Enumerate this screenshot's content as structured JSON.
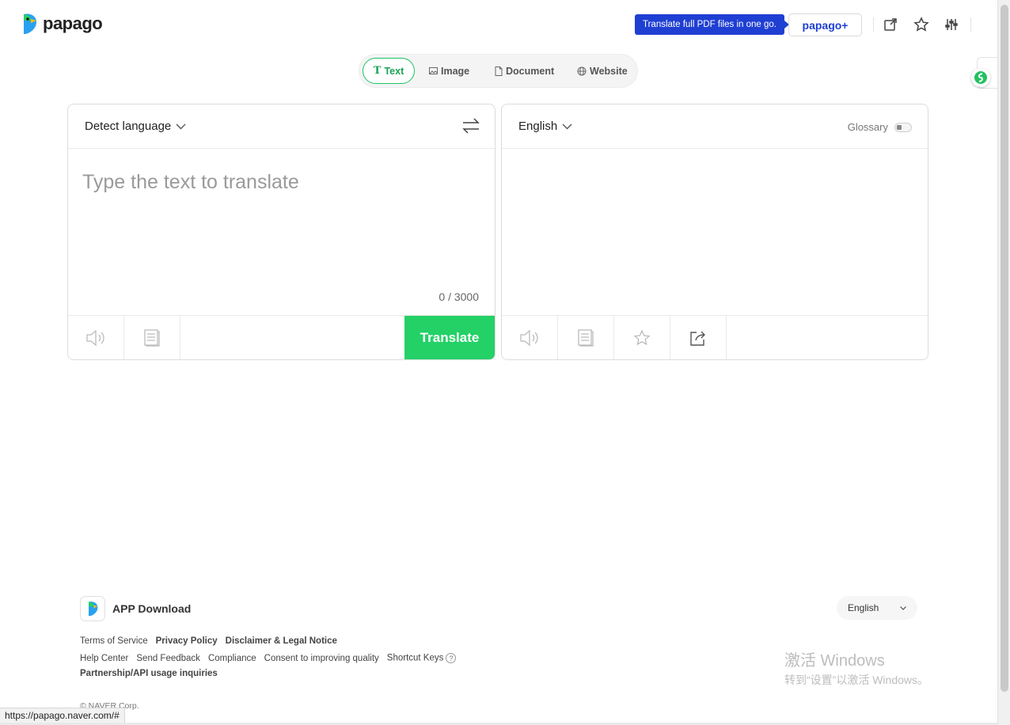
{
  "header": {
    "logo_text": "papago",
    "promo_text": "Translate full PDF files in one go.",
    "papago_plus_label": "papago+",
    "icons": [
      "popout-icon",
      "star-icon",
      "settings-sliders-icon"
    ]
  },
  "modes": [
    {
      "label": "Text",
      "icon": "text-icon",
      "active": true
    },
    {
      "label": "Image",
      "icon": "image-icon",
      "active": false
    },
    {
      "label": "Document",
      "icon": "document-icon",
      "active": false
    },
    {
      "label": "Website",
      "icon": "globe-icon",
      "active": false
    }
  ],
  "source": {
    "language": "Detect language",
    "placeholder": "Type the text to translate",
    "counter": "0 / 3000",
    "translate_label": "Translate"
  },
  "target": {
    "language": "English",
    "glossary_label": "Glossary"
  },
  "footer": {
    "app_download": "APP Download",
    "links_row1": [
      "Terms of Service",
      "Privacy Policy",
      "Disclaimer & Legal Notice"
    ],
    "links_row2": [
      "Help Center",
      "Send Feedback",
      "Compliance",
      "Consent to improving quality",
      "Shortcut Keys"
    ],
    "links_row3": [
      "Partnership/API usage inquiries"
    ],
    "copyright": "© NAVER Corp.",
    "language_select": "English"
  },
  "os_overlay": {
    "watermark_line1": "激活 Windows",
    "watermark_line2": "转到“设置”以激活 Windows。",
    "status_url": "https://papago.naver.com/#"
  },
  "colors": {
    "accent_green": "#23d166",
    "brand_blue": "#1f3fd3"
  }
}
